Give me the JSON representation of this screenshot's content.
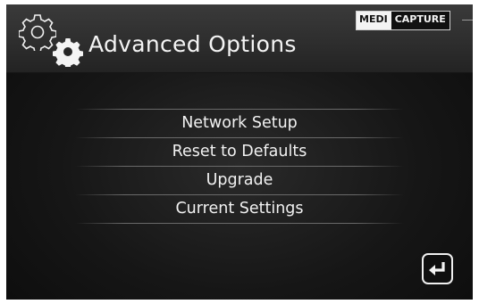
{
  "header": {
    "title": "Advanced Options",
    "icon": "gears-icon"
  },
  "logo": {
    "part1": "MEDI",
    "part2": "CAPTURE"
  },
  "menu": {
    "items": [
      {
        "label": "Network Setup"
      },
      {
        "label": "Reset to Defaults"
      },
      {
        "label": "Upgrade"
      },
      {
        "label": "Current Settings"
      }
    ]
  },
  "footer": {
    "enter_icon": "enter-return-icon"
  },
  "colors": {
    "background": "#161616",
    "header": "#2e2e2e",
    "text": "#f2f2f2",
    "divider": "#6a6a6a"
  }
}
